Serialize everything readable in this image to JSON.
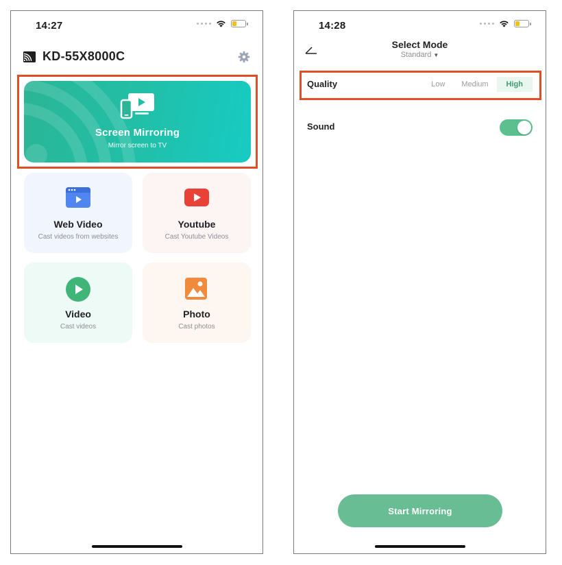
{
  "left_screen": {
    "status_time": "14:27",
    "device_name": "KD-55X8000C",
    "mirror_card": {
      "title": "Screen Mirroring",
      "subtitle": "Mirror screen to TV"
    },
    "features": [
      {
        "title": "Web Video",
        "subtitle": "Cast videos from websites",
        "icon": "browser-play-icon",
        "color": "#4f86f0"
      },
      {
        "title": "Youtube",
        "subtitle": "Cast Youtube Videos",
        "icon": "youtube-icon",
        "color": "#ea4136"
      },
      {
        "title": "Video",
        "subtitle": "Cast videos",
        "icon": "video-play-icon",
        "color": "#3fb578"
      },
      {
        "title": "Photo",
        "subtitle": "Cast photos",
        "icon": "photo-icon",
        "color": "#f08a3c"
      }
    ]
  },
  "right_screen": {
    "status_time": "14:28",
    "title": "Select Mode",
    "mode_value": "Standard",
    "quality": {
      "label": "Quality",
      "options": [
        "Low",
        "Medium",
        "High"
      ],
      "selected": "High"
    },
    "sound": {
      "label": "Sound",
      "enabled": true
    },
    "start_button": "Start Mirroring"
  },
  "colors": {
    "accent_green": "#5bbf8e",
    "mirror_card_start": "#2bb595",
    "mirror_card_end": "#17cbc3",
    "highlight": "#e24d23",
    "battery": "#f3bf1c"
  }
}
